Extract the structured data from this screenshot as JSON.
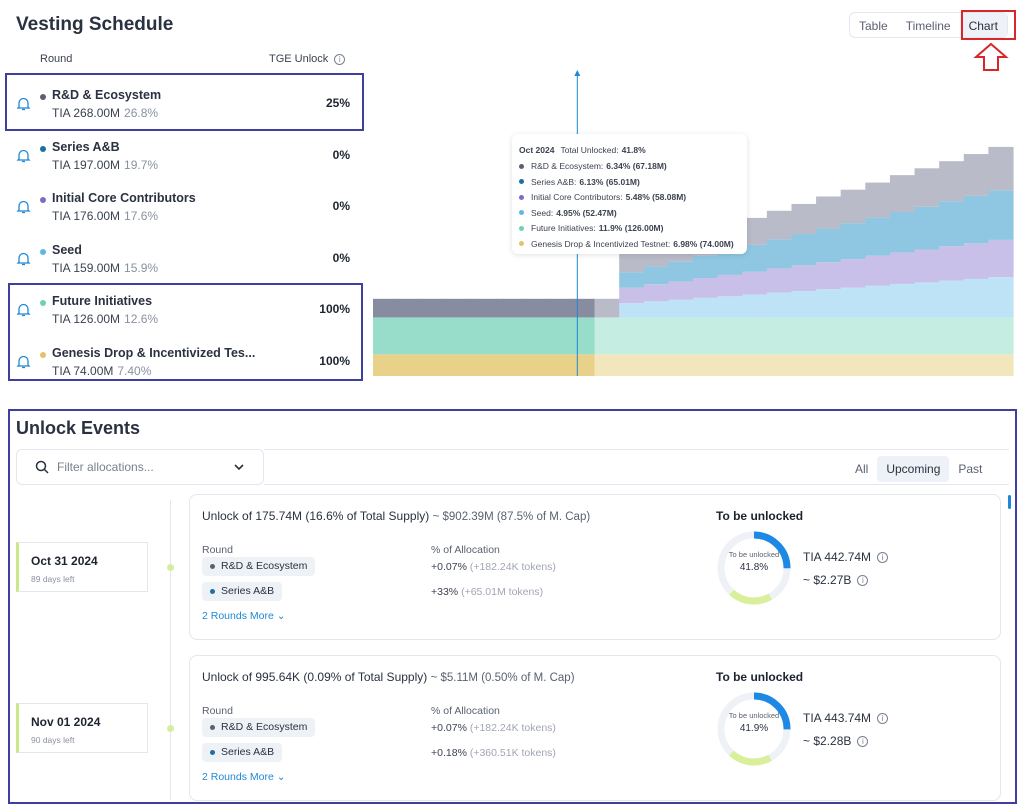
{
  "vesting": {
    "title": "Vesting Schedule",
    "col_round": "Round",
    "col_tge": "TGE Unlock",
    "rows": [
      {
        "name": "R&D & Ecosystem",
        "amount": "TIA 268.00M",
        "share": "26.8%",
        "tge": "25%",
        "color": "#5b5f73"
      },
      {
        "name": "Series A&B",
        "amount": "TIA 197.00M",
        "share": "19.7%",
        "tge": "0%",
        "color": "#1d6fa5"
      },
      {
        "name": "Initial Core Contributors",
        "amount": "TIA 176.00M",
        "share": "17.6%",
        "tge": "0%",
        "color": "#7b6cc4"
      },
      {
        "name": "Seed",
        "amount": "TIA 159.00M",
        "share": "15.9%",
        "tge": "0%",
        "color": "#5bb8e8"
      },
      {
        "name": "Future Initiatives",
        "amount": "TIA 126.00M",
        "share": "12.6%",
        "tge": "100%",
        "color": "#6fd0b4"
      },
      {
        "name": "Genesis Drop & Incentivized Tes...",
        "amount": "TIA 74.00M",
        "share": "7.40%",
        "tge": "100%",
        "color": "#e0c46a"
      }
    ]
  },
  "view_tabs": [
    "Table",
    "Timeline",
    "Chart"
  ],
  "active_view": "Chart",
  "tooltip": {
    "date": "Oct 2024",
    "total_label": "Total Unlocked:",
    "total": "41.8%",
    "items": [
      {
        "label": "R&D & Ecosystem:",
        "value": "6.34% (67.18M)",
        "color": "#5b5f73"
      },
      {
        "label": "Series A&B:",
        "value": "6.13% (65.01M)",
        "color": "#1d6fa5"
      },
      {
        "label": "Initial Core Contributors:",
        "value": "5.48% (58.08M)",
        "color": "#7b6cc4"
      },
      {
        "label": "Seed:",
        "value": "4.95% (52.47M)",
        "color": "#5bb8e8"
      },
      {
        "label": "Future Initiatives:",
        "value": "11.9% (126.00M)",
        "color": "#6fd0b4"
      },
      {
        "label": "Genesis Drop & Incentivized Testnet:",
        "value": "6.98% (74.00M)",
        "color": "#e0c46a"
      }
    ]
  },
  "chart_data": {
    "type": "area",
    "stacked": true,
    "step": true,
    "ylim": [
      0,
      100
    ],
    "grid": false,
    "marker_x": 8.3,
    "marker_label": "Oct 2024",
    "x": [
      0,
      1,
      2,
      3,
      4,
      5,
      6,
      7,
      8,
      9,
      10,
      11,
      12,
      13,
      14,
      15,
      16,
      17,
      18,
      19,
      20,
      21,
      22,
      23,
      24,
      25
    ],
    "series": [
      {
        "name": "Genesis Drop & Incentivized Testnet",
        "color": "#e8d28a",
        "future_color": "#f2e6bd",
        "values": [
          7,
          7,
          7,
          7,
          7,
          7,
          7,
          7,
          7,
          7,
          7,
          7,
          7,
          7,
          7,
          7,
          7,
          7,
          7,
          7,
          7,
          7,
          7,
          7,
          7,
          7
        ]
      },
      {
        "name": "Future Initiatives",
        "color": "#97ddc9",
        "future_color": "#c6ede1",
        "values": [
          11.9,
          11.9,
          11.9,
          11.9,
          11.9,
          11.9,
          11.9,
          11.9,
          11.9,
          11.9,
          11.9,
          11.9,
          11.9,
          11.9,
          11.9,
          11.9,
          11.9,
          11.9,
          11.9,
          11.9,
          11.9,
          11.9,
          11.9,
          11.9,
          11.9,
          11.9
        ]
      },
      {
        "name": "Seed",
        "color": "#bfe3f6",
        "future_color": "#bfe3f6",
        "values": [
          0,
          0,
          0,
          0,
          0,
          0,
          0,
          0,
          0,
          0,
          4.6,
          5.2,
          5.7,
          6.3,
          6.8,
          7.4,
          8.0,
          8.5,
          9.1,
          9.6,
          10.2,
          10.8,
          11.3,
          11.9,
          12.4,
          13.0
        ]
      },
      {
        "name": "Initial Core Contributors",
        "color": "#c9c0ea",
        "future_color": "#c9c0ea",
        "values": [
          0,
          0,
          0,
          0,
          0,
          0,
          0,
          0,
          0,
          0,
          5.0,
          5.5,
          5.9,
          6.4,
          6.9,
          7.3,
          7.8,
          8.3,
          8.7,
          9.2,
          9.7,
          10.1,
          10.6,
          11.1,
          11.5,
          12.0
        ]
      },
      {
        "name": "Series A&B",
        "color": "#8fc7e2",
        "future_color": "#8fc7e2",
        "values": [
          0,
          0,
          0,
          0,
          0,
          0,
          0,
          0,
          0,
          0,
          5.0,
          5.7,
          6.5,
          7.2,
          7.9,
          8.7,
          9.4,
          10.1,
          10.9,
          11.6,
          12.3,
          13.1,
          13.8,
          14.5,
          15.3,
          16.0
        ]
      },
      {
        "name": "R&D & Ecosystem",
        "color": "#878ca0",
        "future_color": "#b9bbc8",
        "values": [
          6,
          6,
          6,
          6,
          6,
          6,
          6,
          6,
          6,
          6,
          6.0,
          6.5,
          7.1,
          7.6,
          8.1,
          8.7,
          9.2,
          9.7,
          10.3,
          10.8,
          11.3,
          11.9,
          12.4,
          12.9,
          13.5,
          14.0
        ]
      }
    ]
  },
  "unlock": {
    "title": "Unlock Events",
    "filter_placeholder": "Filter allocations...",
    "tabs": [
      "All",
      "Upcoming",
      "Past"
    ],
    "active_tab": "Upcoming",
    "events": [
      {
        "date": "Oct 31 2024",
        "days_left": "89 days left",
        "headline": "Unlock of 175.74M (16.6% of Total Supply)",
        "usd": "~ $902.39M (87.5% of M. Cap)",
        "col_round": "Round",
        "col_alloc": "% of Allocation",
        "rounds": [
          {
            "name": "R&D & Ecosystem",
            "color": "#5b5f73",
            "pct": "+0.07%",
            "tokens": "(+182.24K tokens)"
          },
          {
            "name": "Series A&B",
            "color": "#1d6fa5",
            "pct": "+33%",
            "tokens": "(+65.01M tokens)"
          }
        ],
        "more": "2 Rounds More",
        "to_be_unlocked": "To be unlocked",
        "donut_label": "To be unlocked",
        "donut_pct": "41.8%",
        "donut_value": 41.8,
        "tia": "TIA 442.74M",
        "usd_total": "~ $2.27B"
      },
      {
        "date": "Nov 01 2024",
        "days_left": "90 days left",
        "headline": "Unlock of 995.64K (0.09% of Total Supply)",
        "usd": "~ $5.11M (0.50% of M. Cap)",
        "col_round": "Round",
        "col_alloc": "% of Allocation",
        "rounds": [
          {
            "name": "R&D & Ecosystem",
            "color": "#5b5f73",
            "pct": "+0.07%",
            "tokens": "(+182.24K tokens)"
          },
          {
            "name": "Series A&B",
            "color": "#1d6fa5",
            "pct": "+0.18%",
            "tokens": "(+360.51K tokens)"
          }
        ],
        "more": "2 Rounds More",
        "to_be_unlocked": "To be unlocked",
        "donut_label": "To be unlocked",
        "donut_pct": "41.9%",
        "donut_value": 41.9,
        "tia": "TIA 443.74M",
        "usd_total": "~ $2.28B"
      }
    ]
  }
}
